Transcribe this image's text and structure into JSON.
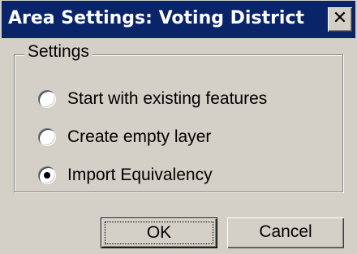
{
  "window": {
    "title": "Area Settings: Voting District",
    "close_icon": "close-icon",
    "close_glyph": "✕"
  },
  "group": {
    "label": "Settings",
    "options": [
      {
        "label": "Start with existing features",
        "selected": false
      },
      {
        "label": "Create empty layer",
        "selected": false
      },
      {
        "label": "Import Equivalency",
        "selected": true
      }
    ]
  },
  "buttons": {
    "ok_label": "OK",
    "cancel_label": "Cancel"
  },
  "colors": {
    "titlebar": "#0a246a",
    "dialog_bg": "#d4d0c8"
  }
}
